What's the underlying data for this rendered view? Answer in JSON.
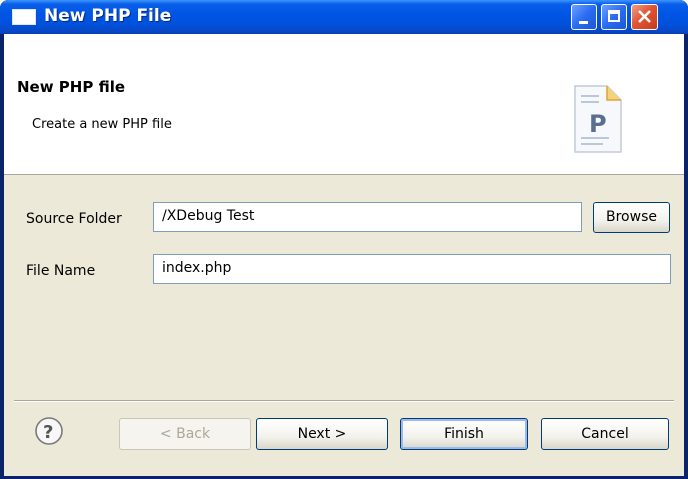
{
  "window": {
    "title": "New PHP File"
  },
  "header": {
    "title": "New PHP file",
    "description": "Create a new PHP file",
    "icon": "php-file-icon"
  },
  "form": {
    "source_folder_label": "Source Folder",
    "source_folder_value": "/XDebug Test",
    "browse_label": "Browse",
    "file_name_label": "File Name",
    "file_name_value": "index.php"
  },
  "buttons": {
    "back": "< Back",
    "next": "Next >",
    "finish": "Finish",
    "cancel": "Cancel"
  },
  "colors": {
    "title_bar": "#0055e5",
    "dialog_bg": "#ece9d8",
    "close_button": "#e05634"
  }
}
